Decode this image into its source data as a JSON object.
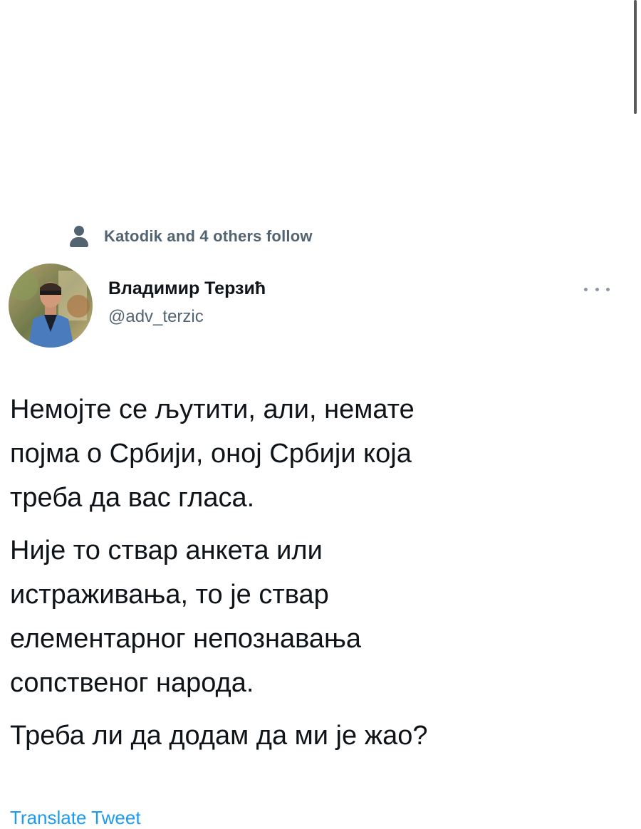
{
  "social_context": {
    "icon": "person-icon",
    "text": "Katodik and 4 others follow"
  },
  "author": {
    "display_name": "Владимир Терзић",
    "handle": "@adv_terzic",
    "avatar": "avatar-photo"
  },
  "more_icon": "more-horizontal-icon",
  "tweet": {
    "paragraphs": [
      "Немојте се љутити, али, немате\nпојма о Србији, оној Србији која\nтреба да вас гласа.",
      "Није то ствар анкета или\nистраживања, то је ствар\nелементарног непознавања\nсопственог народа.",
      "Треба ли да додам да ми је жао?"
    ]
  },
  "translate_label": "Translate Tweet",
  "colors": {
    "text_primary": "#0f1419",
    "text_secondary": "#536471",
    "accent": "#1d9bf0"
  }
}
